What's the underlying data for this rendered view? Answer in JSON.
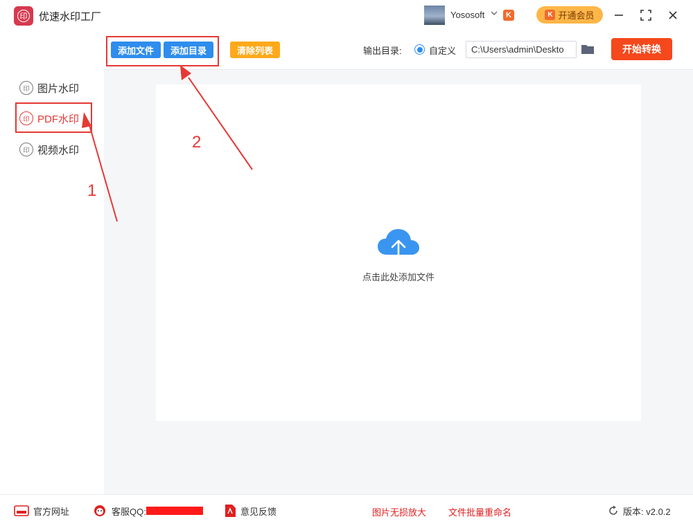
{
  "app": {
    "title": "优速水印工厂",
    "logo_text": "印"
  },
  "user": {
    "name": "Yososoft"
  },
  "vip": {
    "label": "开通会员",
    "badge": "K"
  },
  "sidebar": {
    "items": [
      {
        "label": "图片水印",
        "icon_text": "印"
      },
      {
        "label": "PDF水印",
        "icon_text": "印"
      },
      {
        "label": "视频水印",
        "icon_text": "印"
      }
    ]
  },
  "toolbar": {
    "add_file": "添加文件",
    "add_dir": "添加目录",
    "clear_list": "清除列表",
    "output_label": "输出目录:",
    "custom_label": "自定义",
    "path_value": "C:\\Users\\admin\\Deskto",
    "start": "开始转换"
  },
  "dropzone": {
    "text": "点击此处添加文件"
  },
  "annotations": {
    "step1": "1",
    "step2": "2"
  },
  "footer": {
    "website": "官方网址",
    "qq_label": "客服QQ:",
    "feedback": "意见反馈",
    "link1": "图片无损放大",
    "link2": "文件批量重命名",
    "version": "版本: v2.0.2"
  },
  "colors": {
    "accent_blue": "#2e8ded",
    "accent_red": "#e53935",
    "start_red": "#f5481c",
    "clear_orange": "#ffa91a",
    "vip_gold": "#ffb648",
    "cloud_blue": "#3a95f0"
  }
}
